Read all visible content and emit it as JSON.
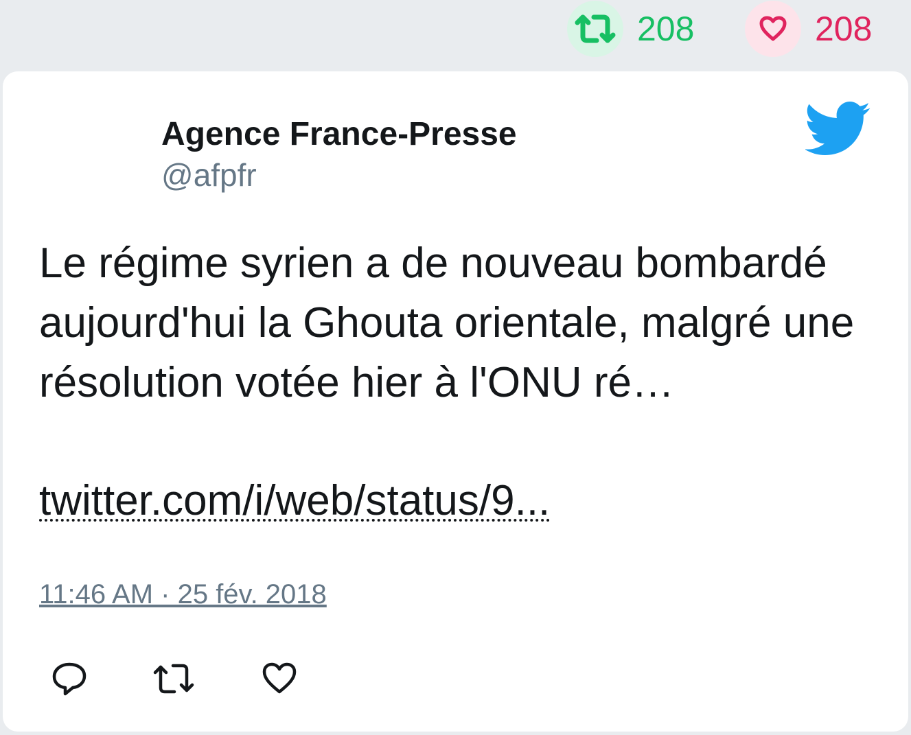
{
  "top_stats": {
    "retweet_count": "208",
    "like_count": "208"
  },
  "tweet": {
    "author_name": "Agence France-Presse",
    "author_handle": "@afpfr",
    "text": "Le régime syrien a de nouveau bombardé aujourd'hui la Ghouta orientale, malgré une résolution votée hier à l'ONU ré…",
    "link": "twitter.com/i/web/status/9...",
    "timestamp": "11:46 AM · 25 fév. 2018"
  },
  "icons": {
    "retweet": "retweet-icon",
    "like": "heart-icon",
    "reply": "reply-icon",
    "brand": "twitter-bird-icon"
  },
  "colors": {
    "retweet_green": "#17bf63",
    "like_red": "#e0245e",
    "twitter_blue": "#1da1f2",
    "muted": "#657786"
  }
}
